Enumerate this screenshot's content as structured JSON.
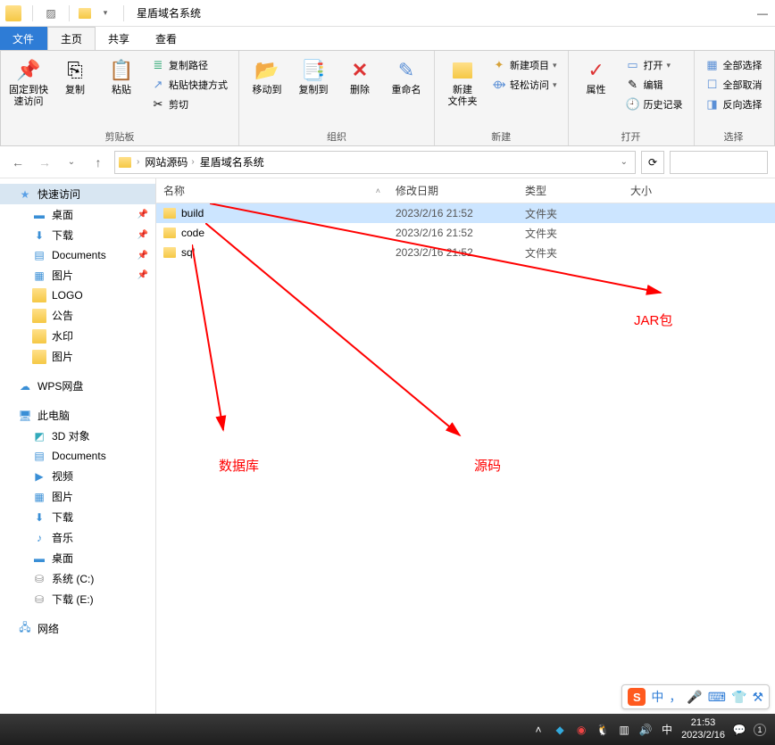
{
  "title": "星盾域名系统",
  "tabs": {
    "file": "文件",
    "home": "主页",
    "share": "共享",
    "view": "查看"
  },
  "ribbon": {
    "clipboard": {
      "pin": "固定到快\n速访问",
      "copy": "复制",
      "paste": "粘贴",
      "copy_path": "复制路径",
      "paste_shortcut": "粘贴快捷方式",
      "cut": "剪切",
      "group": "剪贴板"
    },
    "organize": {
      "moveto": "移动到",
      "copyto": "复制到",
      "delete": "删除",
      "rename": "重命名",
      "group": "组织"
    },
    "new": {
      "newfolder": "新建\n文件夹",
      "newitem": "新建项目",
      "easyaccess": "轻松访问",
      "group": "新建"
    },
    "open": {
      "properties": "属性",
      "open": "打开",
      "edit": "编辑",
      "history": "历史记录",
      "group": "打开"
    },
    "select": {
      "selectall": "全部选择",
      "selectnone": "全部取消",
      "invert": "反向选择",
      "group": "选择"
    }
  },
  "breadcrumbs": [
    "网站源码",
    "星盾域名系统"
  ],
  "columns": {
    "name": "名称",
    "date": "修改日期",
    "type": "类型",
    "size": "大小"
  },
  "files": [
    {
      "name": "build",
      "date": "2023/2/16 21:52",
      "type": "文件夹",
      "selected": true
    },
    {
      "name": "code",
      "date": "2023/2/16 21:52",
      "type": "文件夹",
      "selected": false
    },
    {
      "name": "sql",
      "date": "2023/2/16 21:52",
      "type": "文件夹",
      "selected": false
    }
  ],
  "tree": {
    "quick": "快速访问",
    "desktop": "桌面",
    "downloads": "下载",
    "documents": "Documents",
    "pictures": "图片",
    "logo": "LOGO",
    "gonggao": "公告",
    "shuiyin": "水印",
    "pictures2": "图片",
    "wps": "WPS网盘",
    "thispc": "此电脑",
    "obj3d": "3D 对象",
    "documents2": "Documents",
    "videos": "视频",
    "pictures3": "图片",
    "downloads2": "下载",
    "music": "音乐",
    "desktop2": "桌面",
    "sysc": "系统 (C:)",
    "dle": "下载 (E:)",
    "network": "网络"
  },
  "annotations": {
    "jar": "JAR包",
    "source": "源码",
    "db": "数据库"
  },
  "ime": {
    "lang": "中",
    "punct": "，"
  },
  "taskbar": {
    "time": "21:53",
    "date": "2023/2/16",
    "ime_lang": "中"
  }
}
